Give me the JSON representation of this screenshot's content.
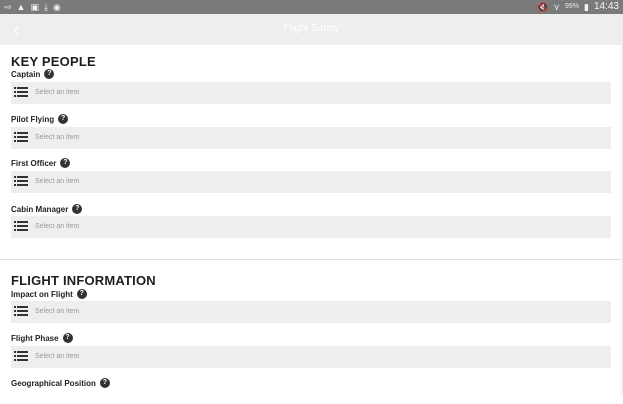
{
  "status_bar": {
    "left_icons": [
      "cast-icon",
      "warning-icon",
      "image-icon",
      "download-icon",
      "android-icon"
    ],
    "left_glyphs": [
      "⇨",
      "▲",
      "▣",
      "⤓",
      "◉"
    ],
    "mute_glyph": "🔇",
    "wifi_glyph": "⋎",
    "battery_text": "99%",
    "time": "14:43"
  },
  "app_bar": {
    "back_glyph": "‹",
    "title": "Flight Safety"
  },
  "sections": {
    "key_people": {
      "title": "KEY PEOPLE",
      "fields": [
        {
          "label": "Captain",
          "placeholder": "Select an item"
        },
        {
          "label": "Pilot Flying",
          "placeholder": "Select an item"
        },
        {
          "label": "First Officer",
          "placeholder": "Select an item"
        },
        {
          "label": "Cabin Manager",
          "placeholder": "Select an item"
        }
      ]
    },
    "flight_information": {
      "title": "FLIGHT INFORMATION",
      "fields": [
        {
          "label": "Impact on Flight",
          "placeholder": "Select an item"
        },
        {
          "label": "Flight Phase",
          "placeholder": "Select an item"
        },
        {
          "label": "Geographical Position"
        }
      ]
    }
  },
  "help_glyph": "?"
}
